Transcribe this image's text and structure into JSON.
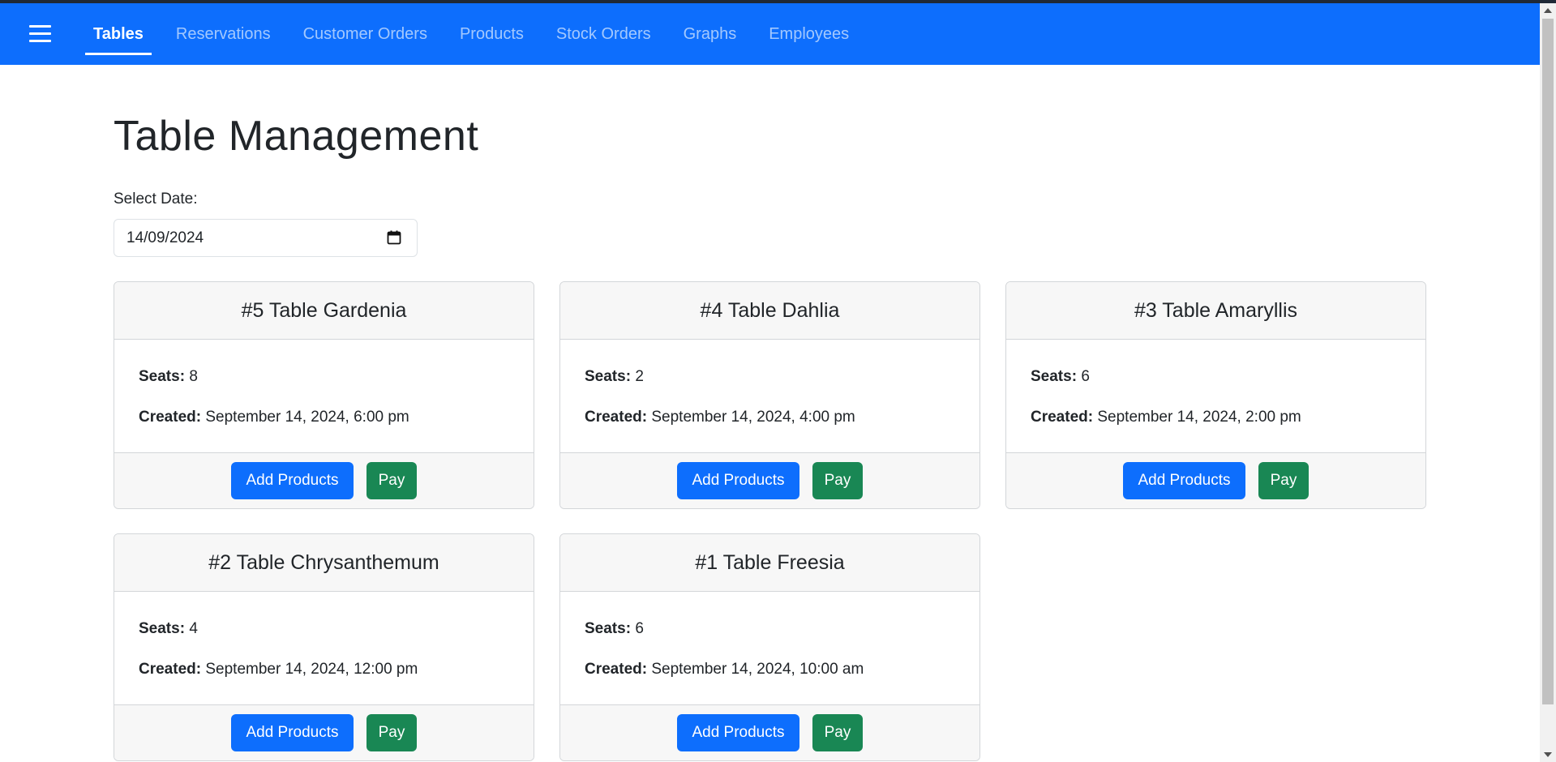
{
  "nav": {
    "items": [
      {
        "label": "Tables",
        "active": true
      },
      {
        "label": "Reservations",
        "active": false
      },
      {
        "label": "Customer Orders",
        "active": false
      },
      {
        "label": "Products",
        "active": false
      },
      {
        "label": "Stock Orders",
        "active": false
      },
      {
        "label": "Graphs",
        "active": false
      },
      {
        "label": "Employees",
        "active": false
      }
    ],
    "menu_icon": "hamburger-icon",
    "color": "#0d6efd"
  },
  "page": {
    "title": "Table Management",
    "date_label": "Select Date:",
    "date_value": "14/09/2024",
    "calendar_icon": "calendar-icon"
  },
  "labels": {
    "seats": "Seats:",
    "created": "Created:",
    "add_products": "Add Products",
    "pay": "Pay"
  },
  "tables": [
    {
      "title": "#5 Table Gardenia",
      "seats": "8",
      "created": "September 14, 2024, 6:00 pm"
    },
    {
      "title": "#4 Table Dahlia",
      "seats": "2",
      "created": "September 14, 2024, 4:00 pm"
    },
    {
      "title": "#3 Table Amaryllis",
      "seats": "6",
      "created": "September 14, 2024, 2:00 pm"
    },
    {
      "title": "#2 Table Chrysanthemum",
      "seats": "4",
      "created": "September 14, 2024, 12:00 pm"
    },
    {
      "title": "#1 Table Freesia",
      "seats": "6",
      "created": "September 14, 2024, 10:00 am"
    }
  ],
  "colors": {
    "primary": "#0d6efd",
    "success": "#198754"
  }
}
